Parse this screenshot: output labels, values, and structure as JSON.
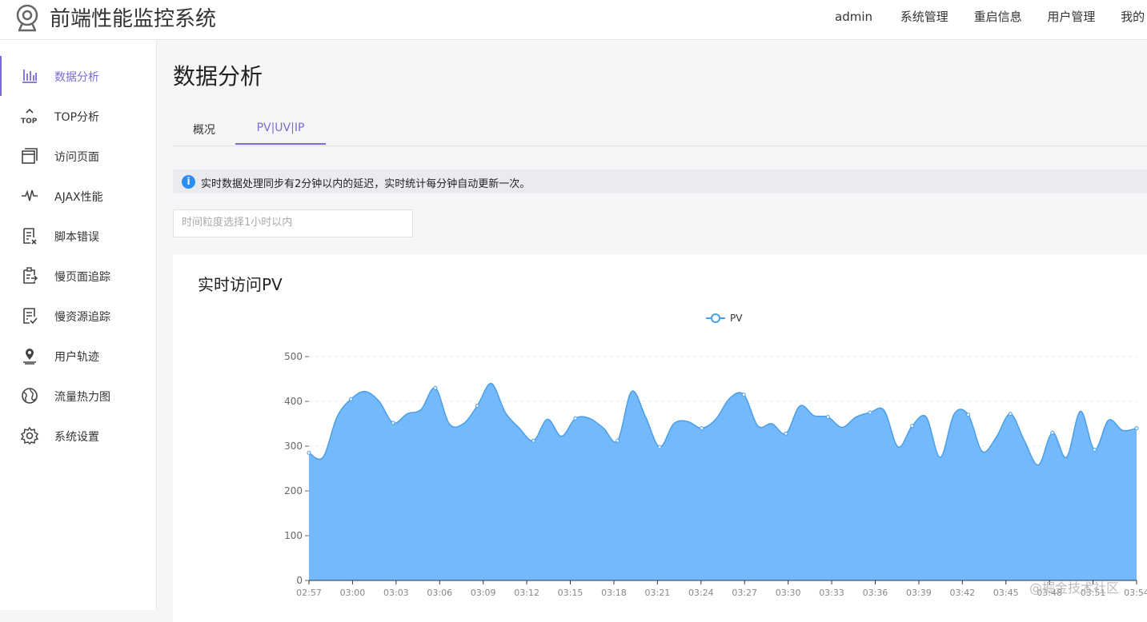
{
  "header": {
    "title": "前端性能监控系统",
    "nav": [
      "admin",
      "系统管理",
      "重启信息",
      "用户管理",
      "我的"
    ]
  },
  "sidebar": {
    "items": [
      {
        "label": "数据分析",
        "icon": "bar-chart-icon",
        "active": true
      },
      {
        "label": "TOP分析",
        "icon": "top-icon"
      },
      {
        "label": "访问页面",
        "icon": "pages-icon"
      },
      {
        "label": "AJAX性能",
        "icon": "pulse-icon"
      },
      {
        "label": "脚本错误",
        "icon": "script-error-icon"
      },
      {
        "label": "慢页面追踪",
        "icon": "clipboard-arrow-icon"
      },
      {
        "label": "慢资源追踪",
        "icon": "checklist-icon"
      },
      {
        "label": "用户轨迹",
        "icon": "location-pin-icon"
      },
      {
        "label": "流量热力图",
        "icon": "globe-icon"
      },
      {
        "label": "系统设置",
        "icon": "gear-icon"
      }
    ]
  },
  "main": {
    "page_title": "数据分析",
    "tabs": [
      {
        "label": "概况"
      },
      {
        "label": "PV|UV|IP",
        "active": true
      }
    ],
    "notice": "实时数据处理同步有2分钟以内的延迟，实时统计每分钟自动更新一次。",
    "granularity_placeholder": "时间粒度选择1小时以内",
    "card_title": "实时访问PV"
  },
  "watermark": "@掘金技术社区",
  "colors": {
    "accent": "#7a6bd7",
    "area": "#74b9fb",
    "line": "#4a9fe8"
  },
  "chart_data": {
    "type": "area",
    "legend": [
      "PV"
    ],
    "x_ticks": [
      "02:57",
      "03:00",
      "03:03",
      "03:06",
      "03:09",
      "03:12",
      "03:15",
      "03:18",
      "03:21",
      "03:24",
      "03:27",
      "03:30",
      "03:33",
      "03:36",
      "03:39",
      "03:42",
      "03:45",
      "03:48",
      "03:51",
      "03:54"
    ],
    "y_ticks": [
      0,
      100,
      200,
      300,
      400,
      500
    ],
    "ylim": [
      0,
      500
    ],
    "series": [
      {
        "name": "PV",
        "values": [
          285,
          275,
          365,
          405,
          422,
          400,
          352,
          372,
          382,
          430,
          350,
          350,
          390,
          440,
          375,
          340,
          312,
          360,
          322,
          362,
          362,
          340,
          312,
          422,
          365,
          298,
          350,
          355,
          340,
          360,
          407,
          415,
          345,
          350,
          328,
          390,
          368,
          365,
          342,
          365,
          375,
          380,
          298,
          345,
          365,
          275,
          372,
          370,
          288,
          320,
          372,
          312,
          258,
          330,
          275,
          378,
          292,
          358,
          335,
          340
        ]
      }
    ]
  }
}
